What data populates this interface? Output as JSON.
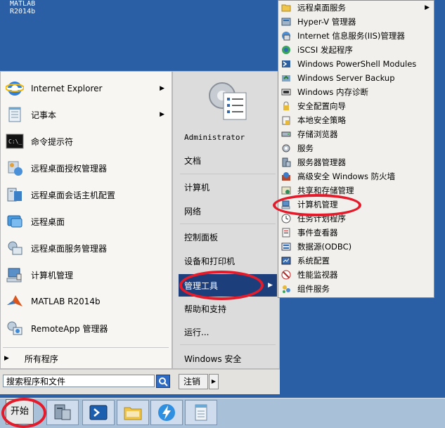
{
  "desktop": {
    "label_line1": "MATLAB",
    "label_line2": "R2014b"
  },
  "left_programs": [
    {
      "label": "Internet Explorer",
      "icon": "ie-icon",
      "has_arrow": true
    },
    {
      "label": "记事本",
      "icon": "notepad-icon",
      "has_arrow": true
    },
    {
      "label": "命令提示符",
      "icon": "cmd-icon",
      "has_arrow": false
    },
    {
      "label": "远程桌面授权管理器",
      "icon": "rd-license-icon",
      "has_arrow": false
    },
    {
      "label": "远程桌面会话主机配置",
      "icon": "rd-session-host-icon",
      "has_arrow": false
    },
    {
      "label": "远程桌面",
      "icon": "remote-desktop-icon",
      "has_arrow": false
    },
    {
      "label": "远程桌面服务管理器",
      "icon": "rd-services-icon",
      "has_arrow": false
    },
    {
      "label": "计算机管理",
      "icon": "computer-management-icon",
      "has_arrow": false
    },
    {
      "label": "MATLAB R2014b",
      "icon": "matlab-icon",
      "has_arrow": false
    },
    {
      "label": "RemoteApp 管理器",
      "icon": "remoteapp-icon",
      "has_arrow": false
    }
  ],
  "all_programs": "所有程序",
  "right_items": [
    {
      "label": "Administrator"
    },
    {
      "label": "文档"
    },
    {
      "label": "计算机"
    },
    {
      "label": "网络"
    },
    {
      "label": "控制面板"
    },
    {
      "label": "设备和打印机"
    },
    {
      "label": "管理工具"
    },
    {
      "label": "帮助和支持"
    },
    {
      "label": "运行..."
    },
    {
      "label": "Windows 安全"
    }
  ],
  "search": {
    "placeholder": "搜索程序和文件",
    "button_icon": "magnifier-icon"
  },
  "logoff": {
    "label": "注销"
  },
  "start": {
    "label": "开始"
  },
  "taskbar_items": [
    {
      "icon": "server-manager-icon"
    },
    {
      "icon": "powershell-icon"
    },
    {
      "icon": "explorer-folder-icon"
    },
    {
      "icon": "lightning-icon"
    },
    {
      "icon": "notepad-taskbar-icon"
    }
  ],
  "submenu": [
    {
      "label": "远程桌面服务",
      "icon": "folder-icon",
      "has_arrow": true
    },
    {
      "label": "Hyper-V 管理器",
      "icon": "hyperv-icon",
      "has_arrow": false
    },
    {
      "label": "Internet 信息服务(IIS)管理器",
      "icon": "iis-icon",
      "has_arrow": false
    },
    {
      "label": "iSCSI 发起程序",
      "icon": "iscsi-icon",
      "has_arrow": false
    },
    {
      "label": "Windows PowerShell Modules",
      "icon": "powershell-modules-icon",
      "has_arrow": false
    },
    {
      "label": "Windows Server Backup",
      "icon": "backup-icon",
      "has_arrow": false
    },
    {
      "label": "Windows 内存诊断",
      "icon": "memory-diagnostic-icon",
      "has_arrow": false
    },
    {
      "label": "安全配置向导",
      "icon": "security-wizard-icon",
      "has_arrow": false
    },
    {
      "label": "本地安全策略",
      "icon": "local-security-icon",
      "has_arrow": false
    },
    {
      "label": "存储浏览器",
      "icon": "storage-explorer-icon",
      "has_arrow": false
    },
    {
      "label": "服务",
      "icon": "services-icon",
      "has_arrow": false
    },
    {
      "label": "服务器管理器",
      "icon": "server-manager-small-icon",
      "has_arrow": false
    },
    {
      "label": "高级安全 Windows 防火墙",
      "icon": "firewall-icon",
      "has_arrow": false
    },
    {
      "label": "共享和存储管理",
      "icon": "share-storage-icon",
      "has_arrow": false
    },
    {
      "label": "计算机管理",
      "icon": "computer-mgmt-small-icon",
      "has_arrow": false
    },
    {
      "label": "任务计划程序",
      "icon": "task-scheduler-icon",
      "has_arrow": false
    },
    {
      "label": "事件查看器",
      "icon": "event-viewer-icon",
      "has_arrow": false
    },
    {
      "label": "数据源(ODBC)",
      "icon": "odbc-icon",
      "has_arrow": false
    },
    {
      "label": "系统配置",
      "icon": "system-config-icon",
      "has_arrow": false
    },
    {
      "label": "性能监视器",
      "icon": "performance-monitor-icon",
      "has_arrow": false
    },
    {
      "label": "组件服务",
      "icon": "component-services-icon",
      "has_arrow": false
    }
  ],
  "colors": {
    "desktop": "#2a5ea5",
    "highlight": "#1c3f7c",
    "annotation": "#e31b2b"
  }
}
